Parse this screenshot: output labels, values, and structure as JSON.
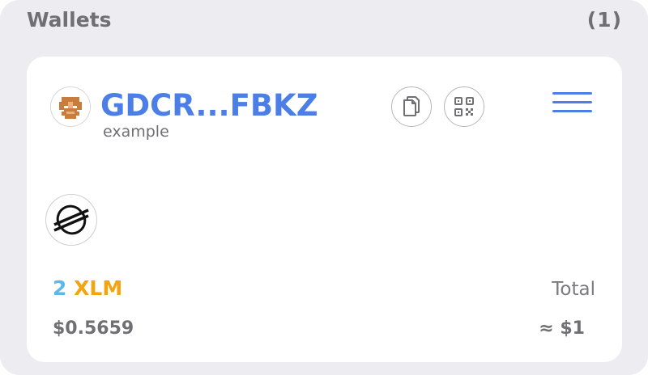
{
  "header": {
    "title": "Wallets",
    "count": "(1)"
  },
  "wallet": {
    "address": "GDCR...FBKZ",
    "name": "example",
    "asset": {
      "amount": "2",
      "code": "XLM",
      "fiat_value": "$0.5659"
    },
    "total_label": "Total",
    "total_value": "≈ $1"
  },
  "icons": {
    "avatar": "identicon-avatar",
    "copy": "copy-icon",
    "qr": "qr-code-icon",
    "menu": "hamburger-menu-icon",
    "asset_logo": "stellar-logo-icon"
  },
  "colors": {
    "accent": "#4c7ee8",
    "amount": "#5bb8ee",
    "asset_code": "#f5a30f",
    "muted_text": "#6f6f74",
    "panel_bg": "#ececf1"
  }
}
